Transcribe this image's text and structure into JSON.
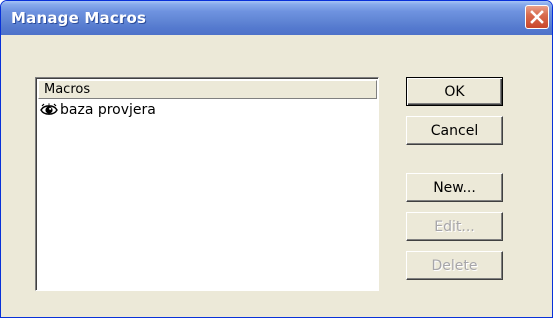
{
  "window": {
    "title": "Manage Macros",
    "close_icon": "close-icon"
  },
  "macro_list": {
    "header": "Macros",
    "items": [
      {
        "icon": "eye-icon",
        "label": "baza provjera"
      }
    ]
  },
  "buttons": {
    "ok": "OK",
    "cancel": "Cancel",
    "new": "New...",
    "edit": "Edit...",
    "delete": "Delete"
  },
  "colors": {
    "titlebar": "#6287d6",
    "dialog_background": "#ece9d8",
    "close_button": "#d96c4f",
    "disabled_text": "#a7a6aa"
  }
}
